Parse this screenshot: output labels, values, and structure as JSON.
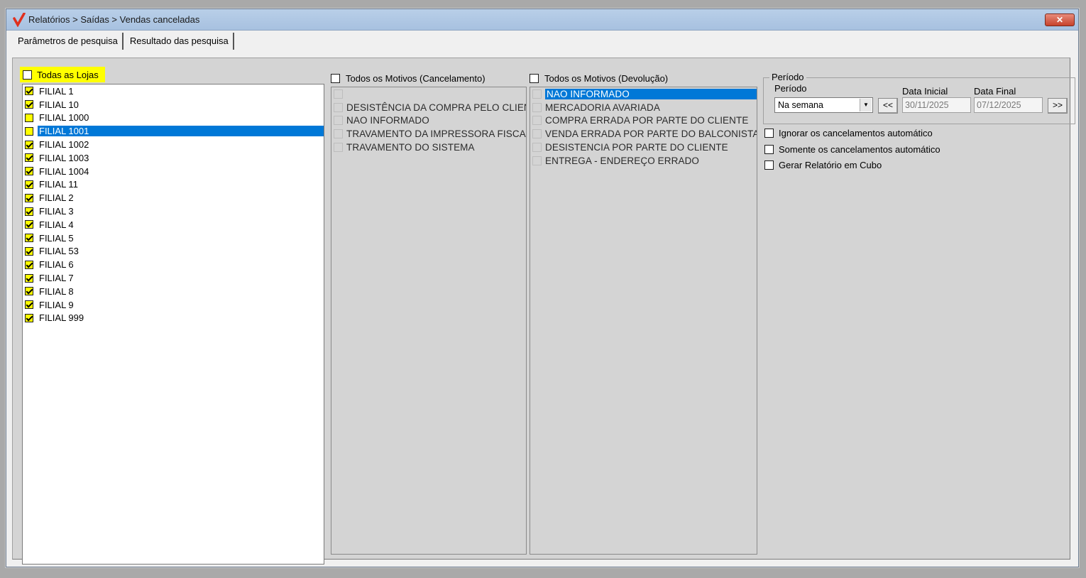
{
  "window": {
    "title": "Relatórios > Saídas > Vendas canceladas",
    "close_label": "✕"
  },
  "tabs": [
    {
      "label": "Parâmetros de pesquisa"
    },
    {
      "label": "Resultado das pesquisa"
    }
  ],
  "shops": {
    "header": "Todas as Lojas",
    "items": [
      {
        "label": "FILIAL 1",
        "checked": true
      },
      {
        "label": "FILIAL 10",
        "checked": true
      },
      {
        "label": "FILIAL 1000",
        "checked": false
      },
      {
        "label": "FILIAL 1001",
        "checked": false,
        "selected": true
      },
      {
        "label": "FILIAL 1002",
        "checked": true
      },
      {
        "label": "FILIAL 1003",
        "checked": true
      },
      {
        "label": "FILIAL 1004",
        "checked": true
      },
      {
        "label": "FILIAL 11",
        "checked": true
      },
      {
        "label": "FILIAL 2",
        "checked": true
      },
      {
        "label": "FILIAL 3",
        "checked": true
      },
      {
        "label": "FILIAL 4",
        "checked": true
      },
      {
        "label": "FILIAL 5",
        "checked": true
      },
      {
        "label": "FILIAL 53",
        "checked": true
      },
      {
        "label": "FILIAL 6",
        "checked": true
      },
      {
        "label": "FILIAL 7",
        "checked": true
      },
      {
        "label": "FILIAL 8",
        "checked": true
      },
      {
        "label": "FILIAL 9",
        "checked": true
      },
      {
        "label": "FILIAL 999",
        "checked": true
      }
    ]
  },
  "cancel_reasons": {
    "header": "Todos os Motivos (Cancelamento)",
    "items": [
      {
        "label": ""
      },
      {
        "label": "DESISTÊNCIA DA COMPRA PELO CLIEN"
      },
      {
        "label": "NAO INFORMADO"
      },
      {
        "label": "TRAVAMENTO DA IMPRESSORA FISCAL"
      },
      {
        "label": "TRAVAMENTO DO SISTEMA"
      }
    ]
  },
  "return_reasons": {
    "header": "Todos os Motivos (Devolução)",
    "items": [
      {
        "label": "NAO INFORMADO",
        "selected": true
      },
      {
        "label": "MERCADORIA AVARIADA"
      },
      {
        "label": "COMPRA ERRADA POR PARTE DO CLIENTE"
      },
      {
        "label": "VENDA ERRADA POR PARTE DO BALCONISTA"
      },
      {
        "label": "DESISTENCIA POR PARTE DO CLIENTE"
      },
      {
        "label": "ENTREGA - ENDEREÇO ERRADO"
      }
    ]
  },
  "periodo": {
    "group_label": "Período",
    "field_label": "Período",
    "selected": "Na semana",
    "prev_label": "<<",
    "next_label": ">>",
    "start_label": "Data Inicial",
    "start_value": "30/11/2025",
    "end_label": "Data Final",
    "end_value": "07/12/2025"
  },
  "options": [
    {
      "label": "Ignorar os cancelamentos automático"
    },
    {
      "label": "Somente os cancelamentos automático"
    },
    {
      "label": "Gerar Relatório em Cubo"
    }
  ],
  "colors": {
    "selection": "#0078d7",
    "highlight": "#ffff00"
  }
}
